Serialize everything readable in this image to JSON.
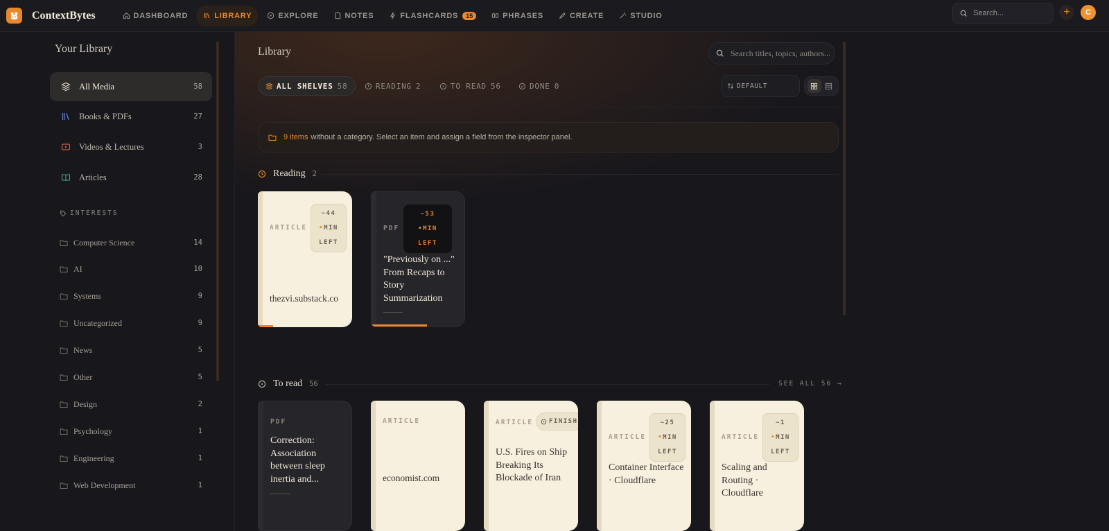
{
  "app": {
    "name": "ContextBytes",
    "avatar_initial": "C"
  },
  "nav": {
    "items": [
      {
        "label": "DASHBOARD",
        "icon": "home-icon"
      },
      {
        "label": "LIBRARY",
        "icon": "library-icon",
        "active": true
      },
      {
        "label": "EXPLORE",
        "icon": "compass-icon"
      },
      {
        "label": "NOTES",
        "icon": "note-icon"
      },
      {
        "label": "FLASHCARDS",
        "icon": "bolt-icon",
        "badge": "15"
      },
      {
        "label": "PHRASES",
        "icon": "quote-icon"
      },
      {
        "label": "CREATE",
        "icon": "pencil-icon"
      },
      {
        "label": "STUDIO",
        "icon": "wand-icon"
      }
    ],
    "search_placeholder": "Search..."
  },
  "sidebar": {
    "title": "Your Library",
    "media": [
      {
        "label": "All Media",
        "count": "58",
        "icon": "layers-icon",
        "active": true
      },
      {
        "label": "Books & PDFs",
        "count": "27",
        "icon": "books-icon"
      },
      {
        "label": "Videos & Lectures",
        "count": "3",
        "icon": "video-icon"
      },
      {
        "label": "Articles",
        "count": "28",
        "icon": "open-book-icon"
      }
    ],
    "interests_label": "INTERESTS",
    "interests": [
      {
        "label": "Computer Science",
        "count": "14"
      },
      {
        "label": "AI",
        "count": "10"
      },
      {
        "label": "Systems",
        "count": "9"
      },
      {
        "label": "Uncategorized",
        "count": "9"
      },
      {
        "label": "News",
        "count": "5"
      },
      {
        "label": "Other",
        "count": "5"
      },
      {
        "label": "Design",
        "count": "2"
      },
      {
        "label": "Psychology",
        "count": "1"
      },
      {
        "label": "Engineering",
        "count": "1"
      },
      {
        "label": "Web Development",
        "count": "1"
      }
    ]
  },
  "main": {
    "title": "Library",
    "search_placeholder": "Search titles, topics, authors...",
    "shelves": [
      {
        "label": "ALL SHELVES",
        "count": "58",
        "active": true
      },
      {
        "label": "READING",
        "count": "2"
      },
      {
        "label": "TO READ",
        "count": "56"
      },
      {
        "label": "DONE",
        "count": "0"
      }
    ],
    "sort_label": "DEFAULT",
    "notice": {
      "highlight": "9 items",
      "text": "without a category. Select an item and assign a field from the inspector panel."
    },
    "reading": {
      "title": "Reading",
      "count": "2",
      "cards": [
        {
          "type": "ARTICLE",
          "title": "thezvi.substack.co",
          "time": [
            "~44",
            "MIN",
            "LEFT"
          ],
          "progress": 0.16
        },
        {
          "type": "PDF",
          "title": "\"Previously on ...\" From Recaps to Story Summarization",
          "time": [
            "~53",
            "MIN",
            "LEFT"
          ],
          "progress": 0.6
        }
      ]
    },
    "to_read": {
      "title": "To read",
      "count": "56",
      "see_all": "SEE ALL 56 →",
      "cards": [
        {
          "type": "PDF",
          "title": "Correction: Association between sleep inertia and..."
        },
        {
          "type": "ARTICLE",
          "title": "economist.com"
        },
        {
          "type": "ARTICLE",
          "title": "U.S. Fires on Ship Breaking Its Blockade of Iran",
          "chip": "FINISH"
        },
        {
          "type": "ARTICLE",
          "title": "Container Interface · Cloudflare",
          "time": [
            "~25",
            "MIN",
            "LEFT"
          ]
        },
        {
          "type": "ARTICLE",
          "title": "Scaling and Routing · Cloudflare",
          "time": [
            "~1",
            "MIN",
            "LEFT"
          ]
        }
      ]
    }
  },
  "colors": {
    "accent": "#e8872b",
    "background": "#18171c",
    "card_light": "#f7f0df",
    "card_dark": "#26252a"
  }
}
